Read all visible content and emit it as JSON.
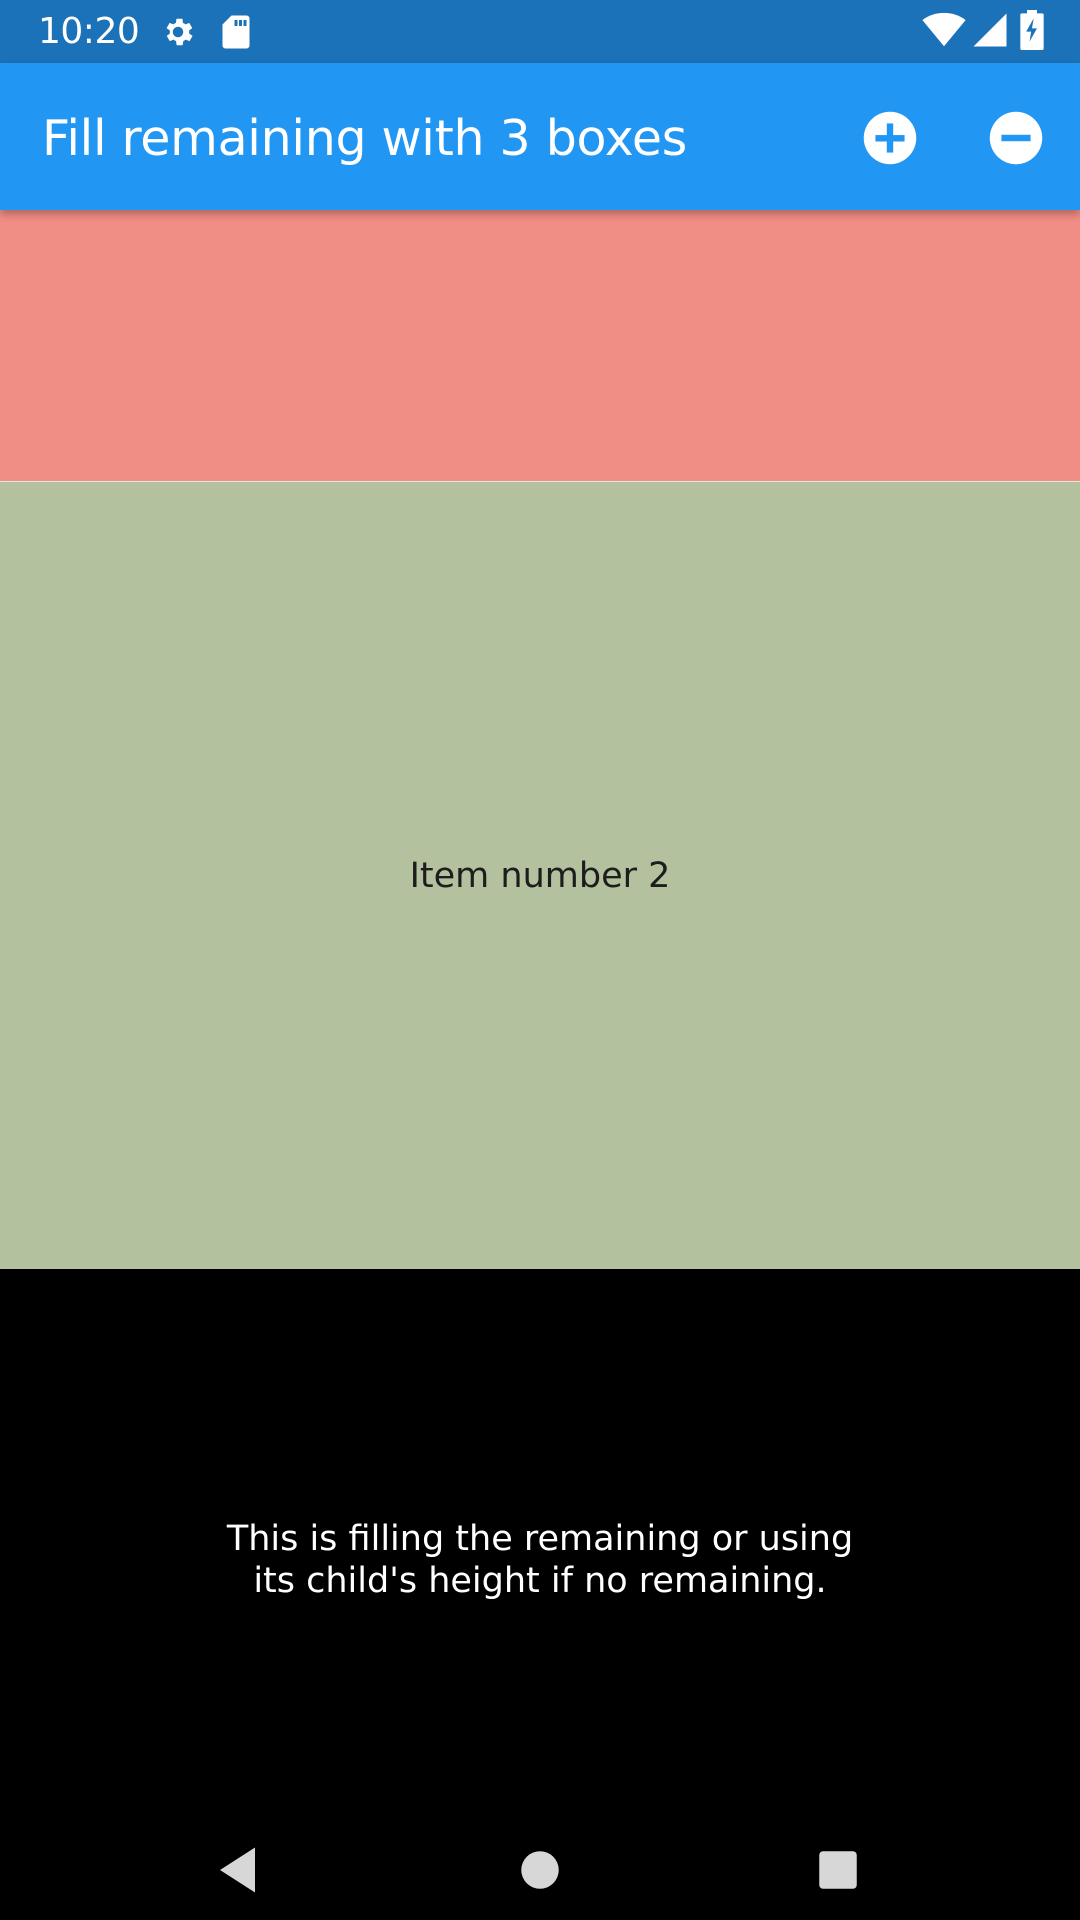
{
  "status_bar": {
    "time": "10:20",
    "icons": [
      "gear-icon",
      "sd-card-icon",
      "wifi-icon",
      "cellular-signal-icon",
      "battery-charging-icon"
    ]
  },
  "app_bar": {
    "title": "Fill remaining with 3 boxes",
    "actions": [
      "add-circle-icon",
      "remove-circle-icon"
    ]
  },
  "boxes": [
    {
      "label": "",
      "color": "#f08d84"
    },
    {
      "label": "Item number 2",
      "color": "#b4c19e"
    },
    {
      "label": "This is filling the remaining or using its child's height if no remaining.",
      "color": "#000000"
    }
  ],
  "nav_bar": {
    "buttons": [
      "back-icon",
      "home-icon",
      "recents-icon"
    ]
  },
  "colors": {
    "status_bar": "#1c72b8",
    "app_bar": "#2196f3"
  }
}
